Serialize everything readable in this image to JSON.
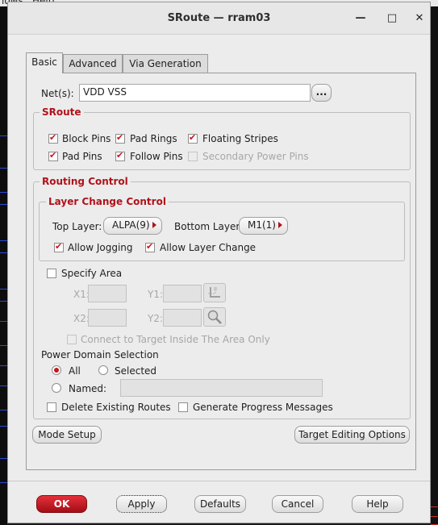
{
  "background": {
    "menu_left": "lows",
    "menu_right": "Help"
  },
  "window": {
    "title": "SRoute — rram03",
    "controls": {
      "minimize": "—",
      "maximize": "□",
      "close": "✕"
    }
  },
  "tabs": [
    {
      "label": "Basic",
      "active": true
    },
    {
      "label": "Advanced",
      "active": false
    },
    {
      "label": "Via Generation",
      "active": false
    }
  ],
  "nets": {
    "label": "Net(s):",
    "value": "VDD VSS",
    "browse": "..."
  },
  "sroute": {
    "title": "SRoute",
    "options": [
      {
        "label": "Block Pins",
        "checked": true,
        "enabled": true
      },
      {
        "label": "Pad Rings",
        "checked": true,
        "enabled": true
      },
      {
        "label": "Floating Stripes",
        "checked": true,
        "enabled": true
      },
      {
        "label": "Pad Pins",
        "checked": true,
        "enabled": true
      },
      {
        "label": "Follow Pins",
        "checked": true,
        "enabled": true
      },
      {
        "label": "Secondary Power Pins",
        "checked": false,
        "enabled": false
      }
    ]
  },
  "routing_control": {
    "title": "Routing Control",
    "layer_change": {
      "title": "Layer Change Control",
      "top_layer_label": "Top Layer:",
      "top_layer_value": "ALPA(9)",
      "bottom_layer_label": "Bottom Layer:",
      "bottom_layer_value": "M1(1)",
      "allow_jogging": "Allow Jogging",
      "allow_layer_change": "Allow Layer Change"
    },
    "specify_area": {
      "label": "Specify Area",
      "checked": false,
      "x1": "X1:",
      "y1": "Y1:",
      "x2": "X2:",
      "y2": "Y2:",
      "connect_target": "Connect to Target Inside The Area Only"
    },
    "power_domain": {
      "label": "Power Domain Selection",
      "all": "All",
      "selected": "Selected",
      "named": "Named:",
      "choice": "All"
    },
    "delete_existing": "Delete Existing Routes",
    "generate_progress": "Generate Progress Messages"
  },
  "panel_buttons": {
    "mode_setup": "Mode Setup",
    "target_editing": "Target Editing Options"
  },
  "dialog_buttons": {
    "ok": "OK",
    "apply": "Apply",
    "defaults": "Defaults",
    "cancel": "Cancel",
    "help": "Help"
  },
  "colors": {
    "accent": "#b0121a",
    "check": "#c8141c",
    "ok_button": "#c41a24",
    "dialog_bg": "#ececec"
  },
  "icons": {
    "area_select": "area-select-icon",
    "zoom_area": "zoom-area-icon"
  }
}
